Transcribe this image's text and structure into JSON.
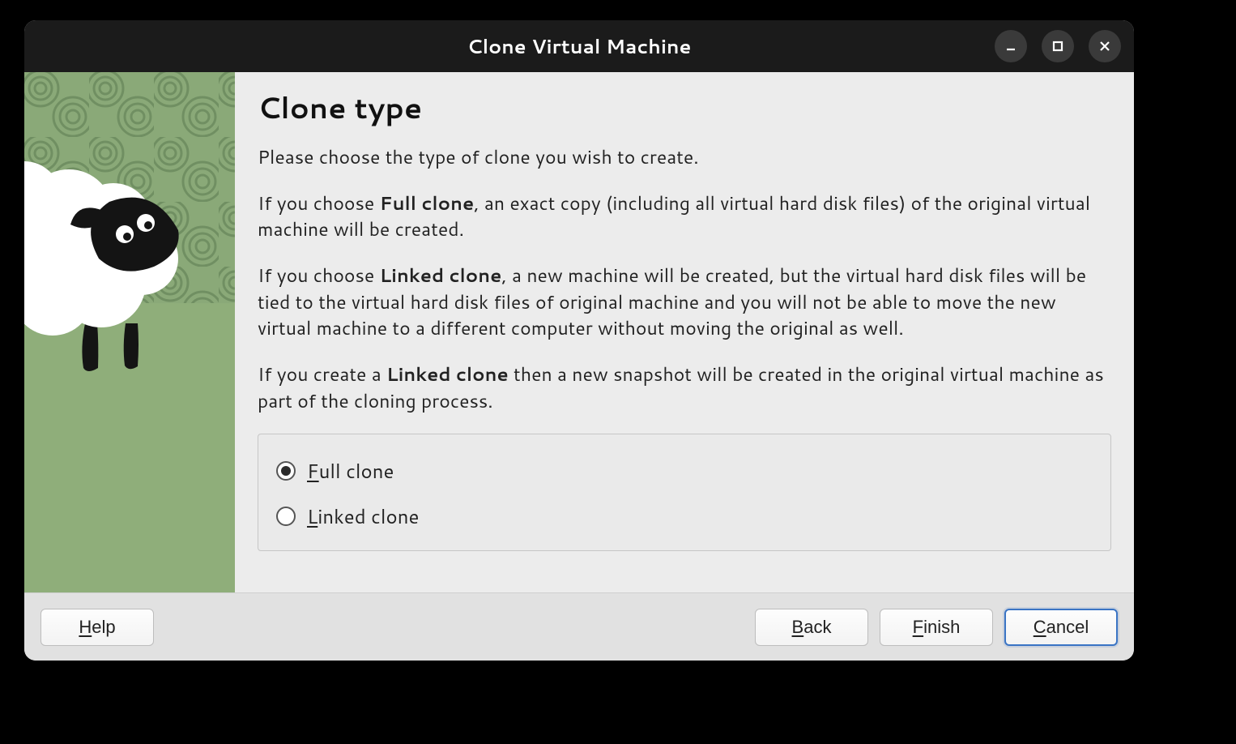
{
  "window": {
    "title": "Clone Virtual Machine"
  },
  "page": {
    "heading": "Clone type",
    "intro": "Please choose the type of clone you wish to create.",
    "full_pre": "If you choose ",
    "full_bold": "Full clone",
    "full_post": ", an exact copy (including all virtual hard disk files) of the original virtual machine will be created.",
    "linked_pre": "If you choose ",
    "linked_bold": "Linked clone",
    "linked_post": ", a new machine will be created, but the virtual hard disk files will be tied to the virtual hard disk files of original machine and you will not be able to move the new virtual machine to a different computer without moving the original as well.",
    "snapshot_pre": "If you create a ",
    "snapshot_bold": "Linked clone",
    "snapshot_post": " then a new snapshot will be created in the original virtual machine as part of the cloning process."
  },
  "options": {
    "full": {
      "mnemonic": "F",
      "rest": "ull clone",
      "checked": true
    },
    "linked": {
      "mnemonic": "L",
      "rest": "inked clone",
      "checked": false
    }
  },
  "buttons": {
    "help": {
      "mnemonic": "H",
      "rest": "elp"
    },
    "back": {
      "mnemonic": "B",
      "rest": "ack"
    },
    "finish": {
      "mnemonic": "F",
      "rest": "inish"
    },
    "cancel": {
      "mnemonic": "C",
      "rest": "ancel"
    }
  },
  "art": {
    "swirl_color": "#8aa978",
    "swirl_line": "#6d8c5f",
    "grass": "#8fae7a",
    "sheep_body": "#ffffff",
    "sheep_face": "#141414",
    "sheep_eye": "#ffffff"
  }
}
